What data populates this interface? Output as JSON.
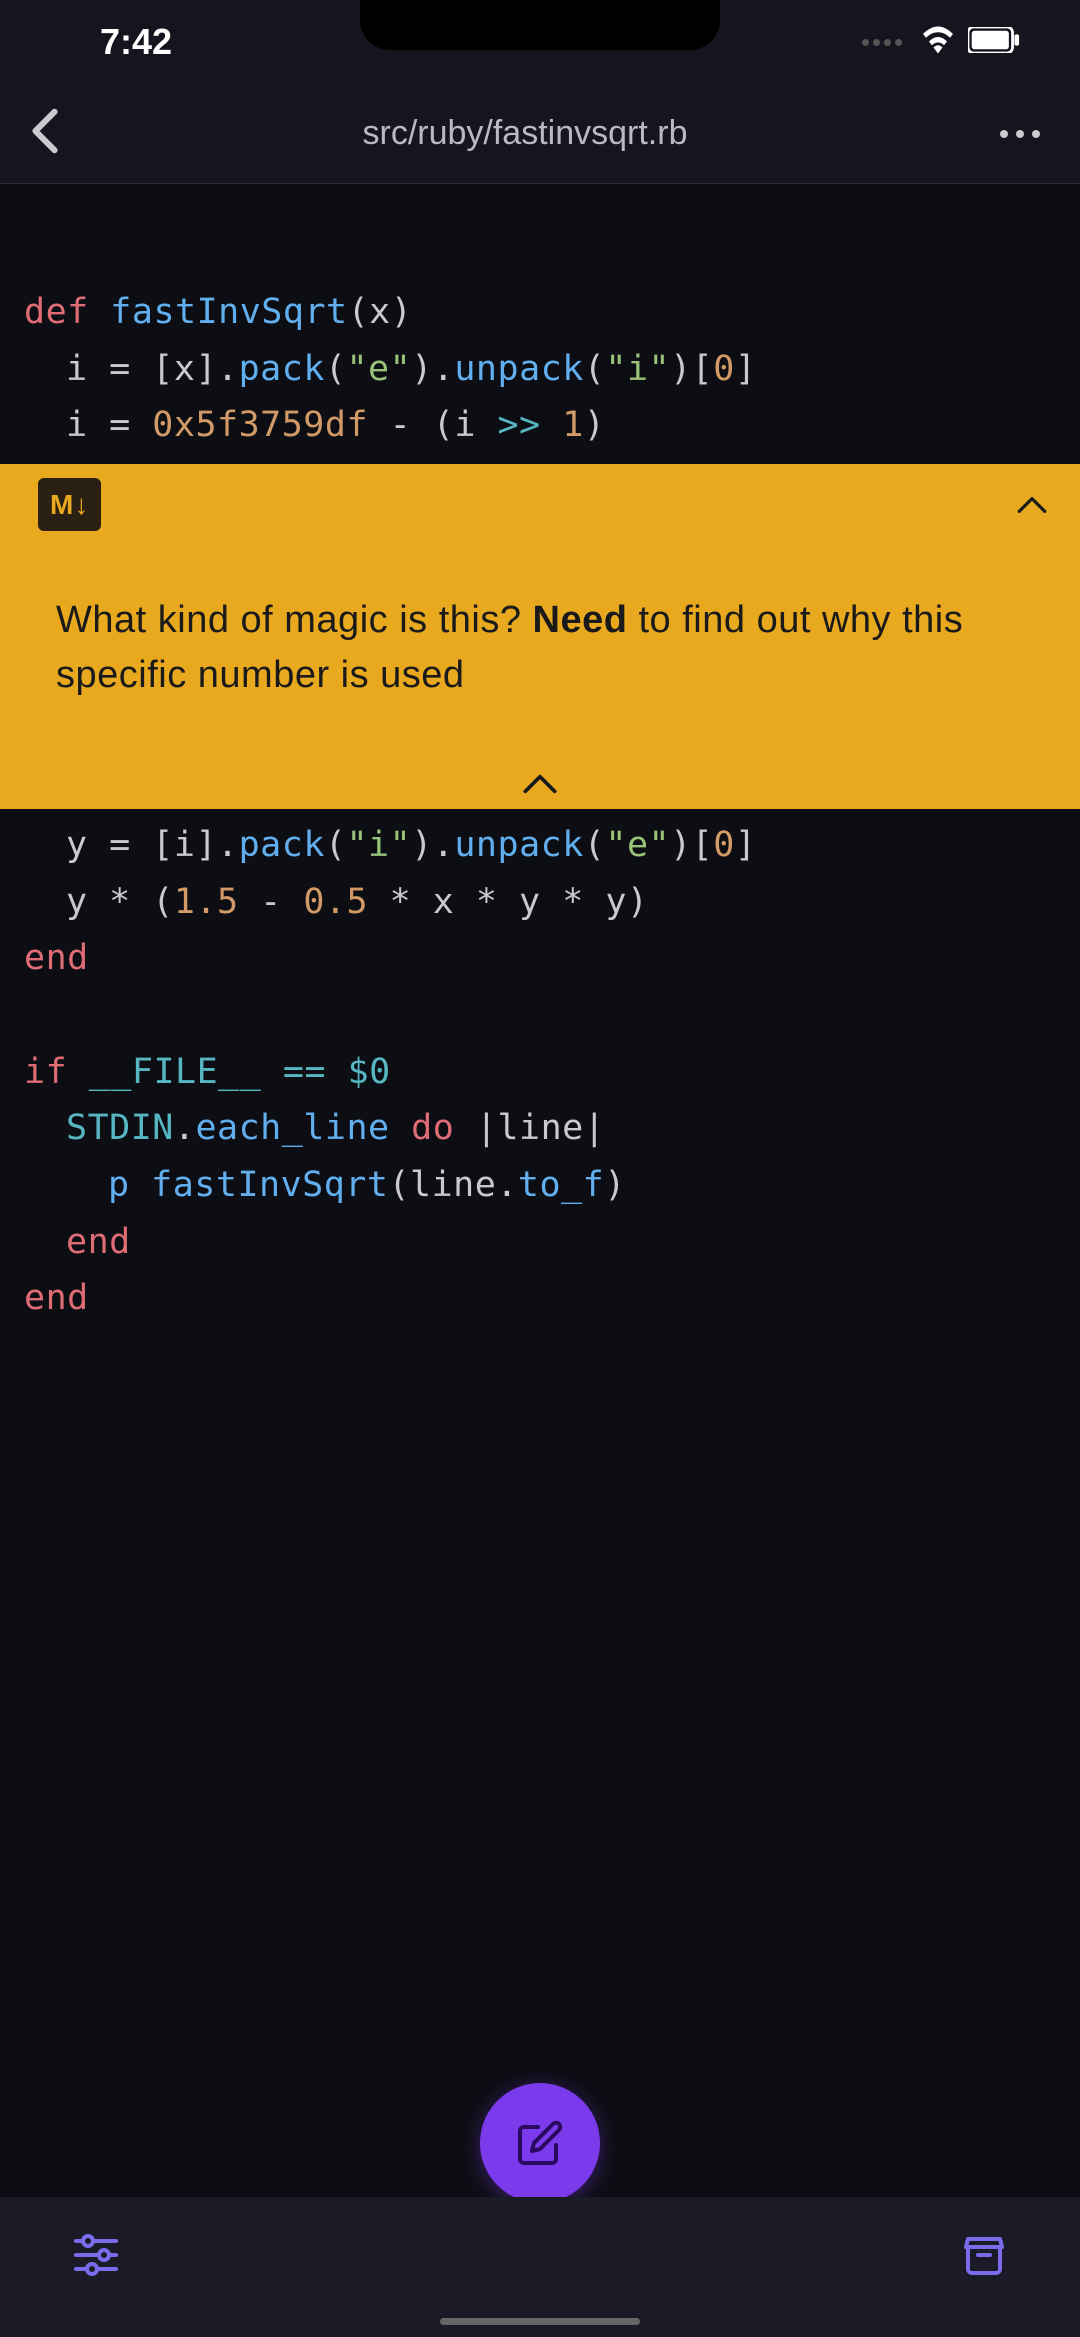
{
  "status": {
    "time": "7:42"
  },
  "header": {
    "title": "src/ruby/fastinvsqrt.rb"
  },
  "code": {
    "line1": {
      "def": "def",
      "fn": "fastInvSqrt",
      "paren_open": "(",
      "arg": "x",
      "paren_close": ")"
    },
    "line2": {
      "var": "i",
      "eq": " = ",
      "lb": "[",
      "x": "x",
      "rb": "]",
      "dot1": ".",
      "pack": "pack",
      "po1": "(",
      "s1": "\"e\"",
      "pc1": ")",
      "dot2": ".",
      "unpack": "unpack",
      "po2": "(",
      "s2": "\"i\"",
      "pc2": ")",
      "idx": "[",
      "zero": "0",
      "idx2": "]"
    },
    "line3": {
      "var": "i",
      "eq": " = ",
      "hex": "0x5f3759df",
      "sub": " - ",
      "po": "(",
      "i2": "i",
      "shift": " >> ",
      "one": "1",
      "pc": ")"
    },
    "line4": {
      "var": "y",
      "eq": " = ",
      "lb": "[",
      "i": "i",
      "rb": "]",
      "dot1": ".",
      "pack": "pack",
      "po1": "(",
      "s1": "\"i\"",
      "pc1": ")",
      "dot2": ".",
      "unpack": "unpack",
      "po2": "(",
      "s2": "\"e\"",
      "pc2": ")",
      "idx": "[",
      "zero": "0",
      "idx2": "]"
    },
    "line5": {
      "var": "y",
      "mul1": " * ",
      "po": "(",
      "n1": "1.5",
      "sub": " - ",
      "n2": "0.5",
      "mul2": " * ",
      "x": "x",
      "mul3": " * ",
      "y2": "y",
      "mul4": " * ",
      "y3": "y",
      "pc": ")"
    },
    "line6": {
      "end": "end"
    },
    "line7": {
      "if": "if",
      "sp": " ",
      "file": "__FILE__",
      "eq": " == ",
      "dollar": "$0"
    },
    "line8": {
      "stdin": "STDIN",
      "dot": ".",
      "each": "each_line",
      "sp": " ",
      "do": "do",
      "pipe": " |line|"
    },
    "line9": {
      "p": "p",
      "sp": " ",
      "fn": "fastInvSqrt",
      "po": "(",
      "line": "line",
      "dot": ".",
      "tof": "to_f",
      "pc": ")"
    },
    "line10": {
      "end": "end"
    },
    "line11": {
      "end": "end"
    }
  },
  "banner": {
    "badge": "M↓",
    "text_before": "What kind of magic is this? ",
    "text_bold": "Need",
    "text_after": " to find out why this specific number is used"
  }
}
